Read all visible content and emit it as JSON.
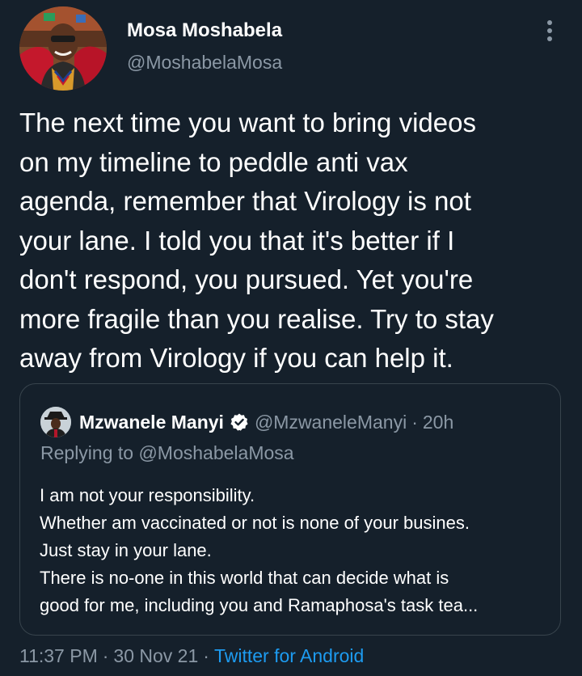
{
  "author": {
    "display_name": "Mosa Moshabela",
    "handle": "@MoshabelaMosa"
  },
  "more_icon": "more-vertical-icon",
  "tweet": {
    "lines": [
      "The next time you want to bring videos",
      "on my timeline to peddle anti vax",
      "agenda, remember that Virology is not",
      "your lane. I told you that it's better if I",
      "don't respond, you pursued. Yet you're",
      "more fragile than you realise. Try to stay",
      "away from Virology if you can help it."
    ]
  },
  "quote": {
    "display_name": "Mzwanele Manyi",
    "verified_icon": "verified-badge-icon",
    "handle": "@MzwaneleManyi",
    "separator": "·",
    "time": "20h",
    "replying_to": "Replying to @MoshabelaMosa",
    "lines": [
      "I am not your responsibility.",
      "Whether am vaccinated or not is none of your busines.",
      "Just stay in your lane.",
      "There is no-one in this world that can decide what is",
      "good for me, including you and Ramaphosa's task tea..."
    ]
  },
  "footer": {
    "time": "11:37 PM",
    "separator": "·",
    "date": "30 Nov 21",
    "source": "Twitter for Android"
  },
  "colors": {
    "background": "#15202b",
    "text_primary": "#ffffff",
    "text_secondary": "#8b98a5",
    "accent": "#1d9bf0",
    "border": "#38444d"
  }
}
